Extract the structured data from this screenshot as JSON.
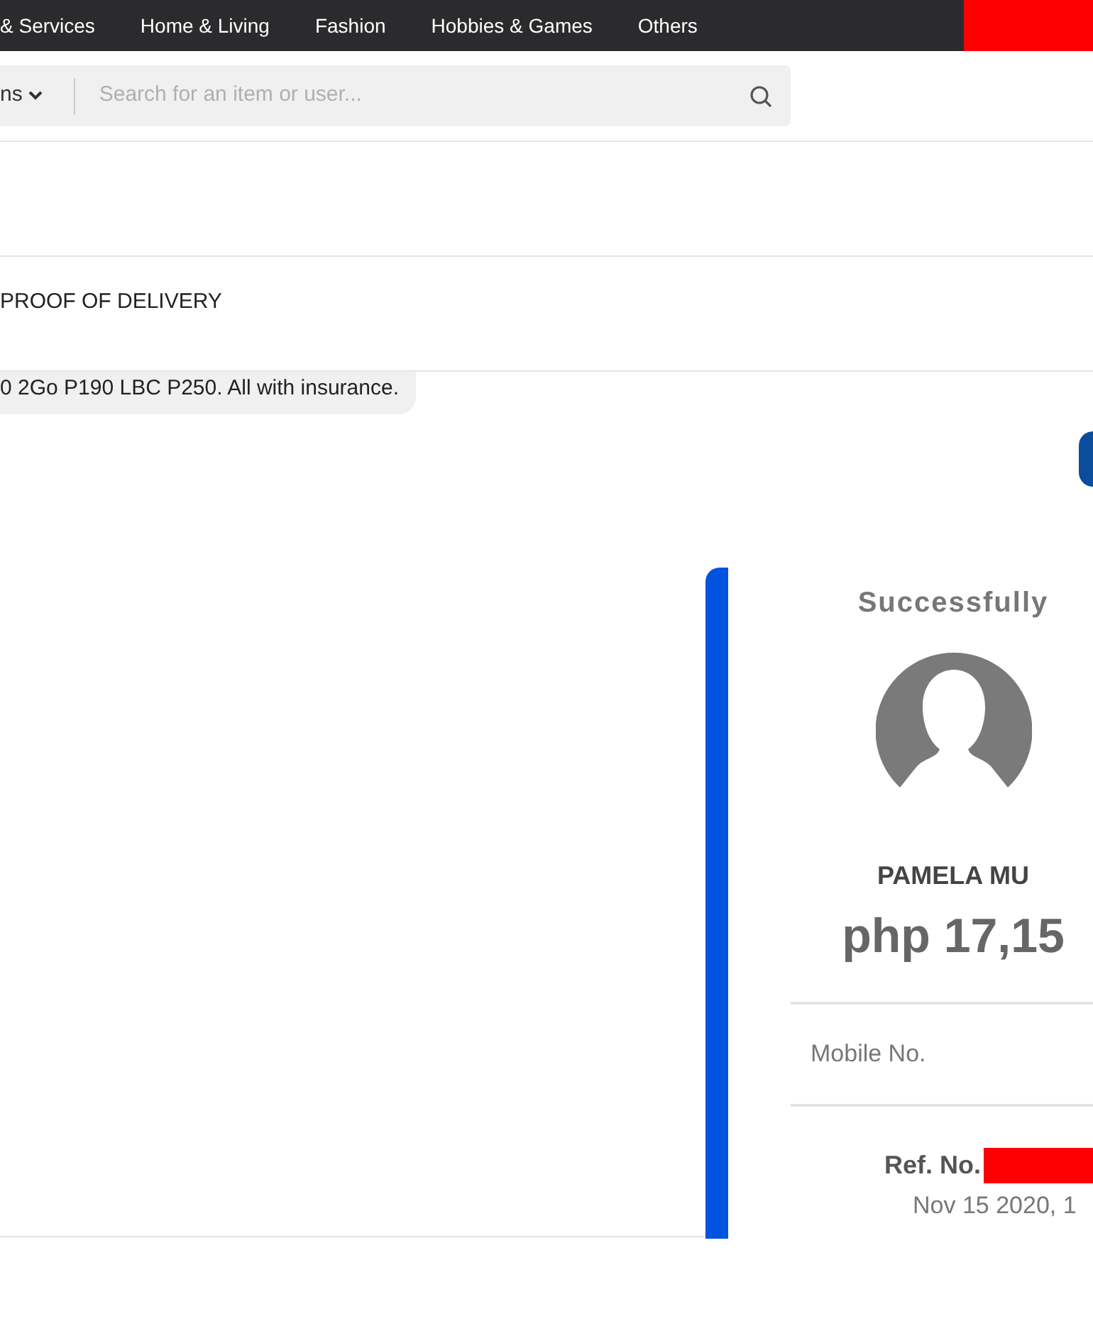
{
  "nav": {
    "categories": [
      "& Services",
      "Home & Living",
      "Fashion",
      "Hobbies & Games",
      "Others"
    ]
  },
  "search": {
    "category": "ns",
    "placeholder": "Search for an item or user..."
  },
  "listing": {
    "title": "PROOF OF DELIVERY"
  },
  "chat": {
    "messages": [
      {
        "kind": "received",
        "text": "0 2Go P190 LBC P250. All with insurance."
      },
      {
        "kind": "sent"
      }
    ],
    "attachment": {
      "status": "Successfully",
      "name": "PAMELA MU",
      "amount": "php 17,15",
      "field_label": "Mobile No.",
      "ref_label": "Ref. No.",
      "date": "Nov 15 2020, 1"
    }
  }
}
